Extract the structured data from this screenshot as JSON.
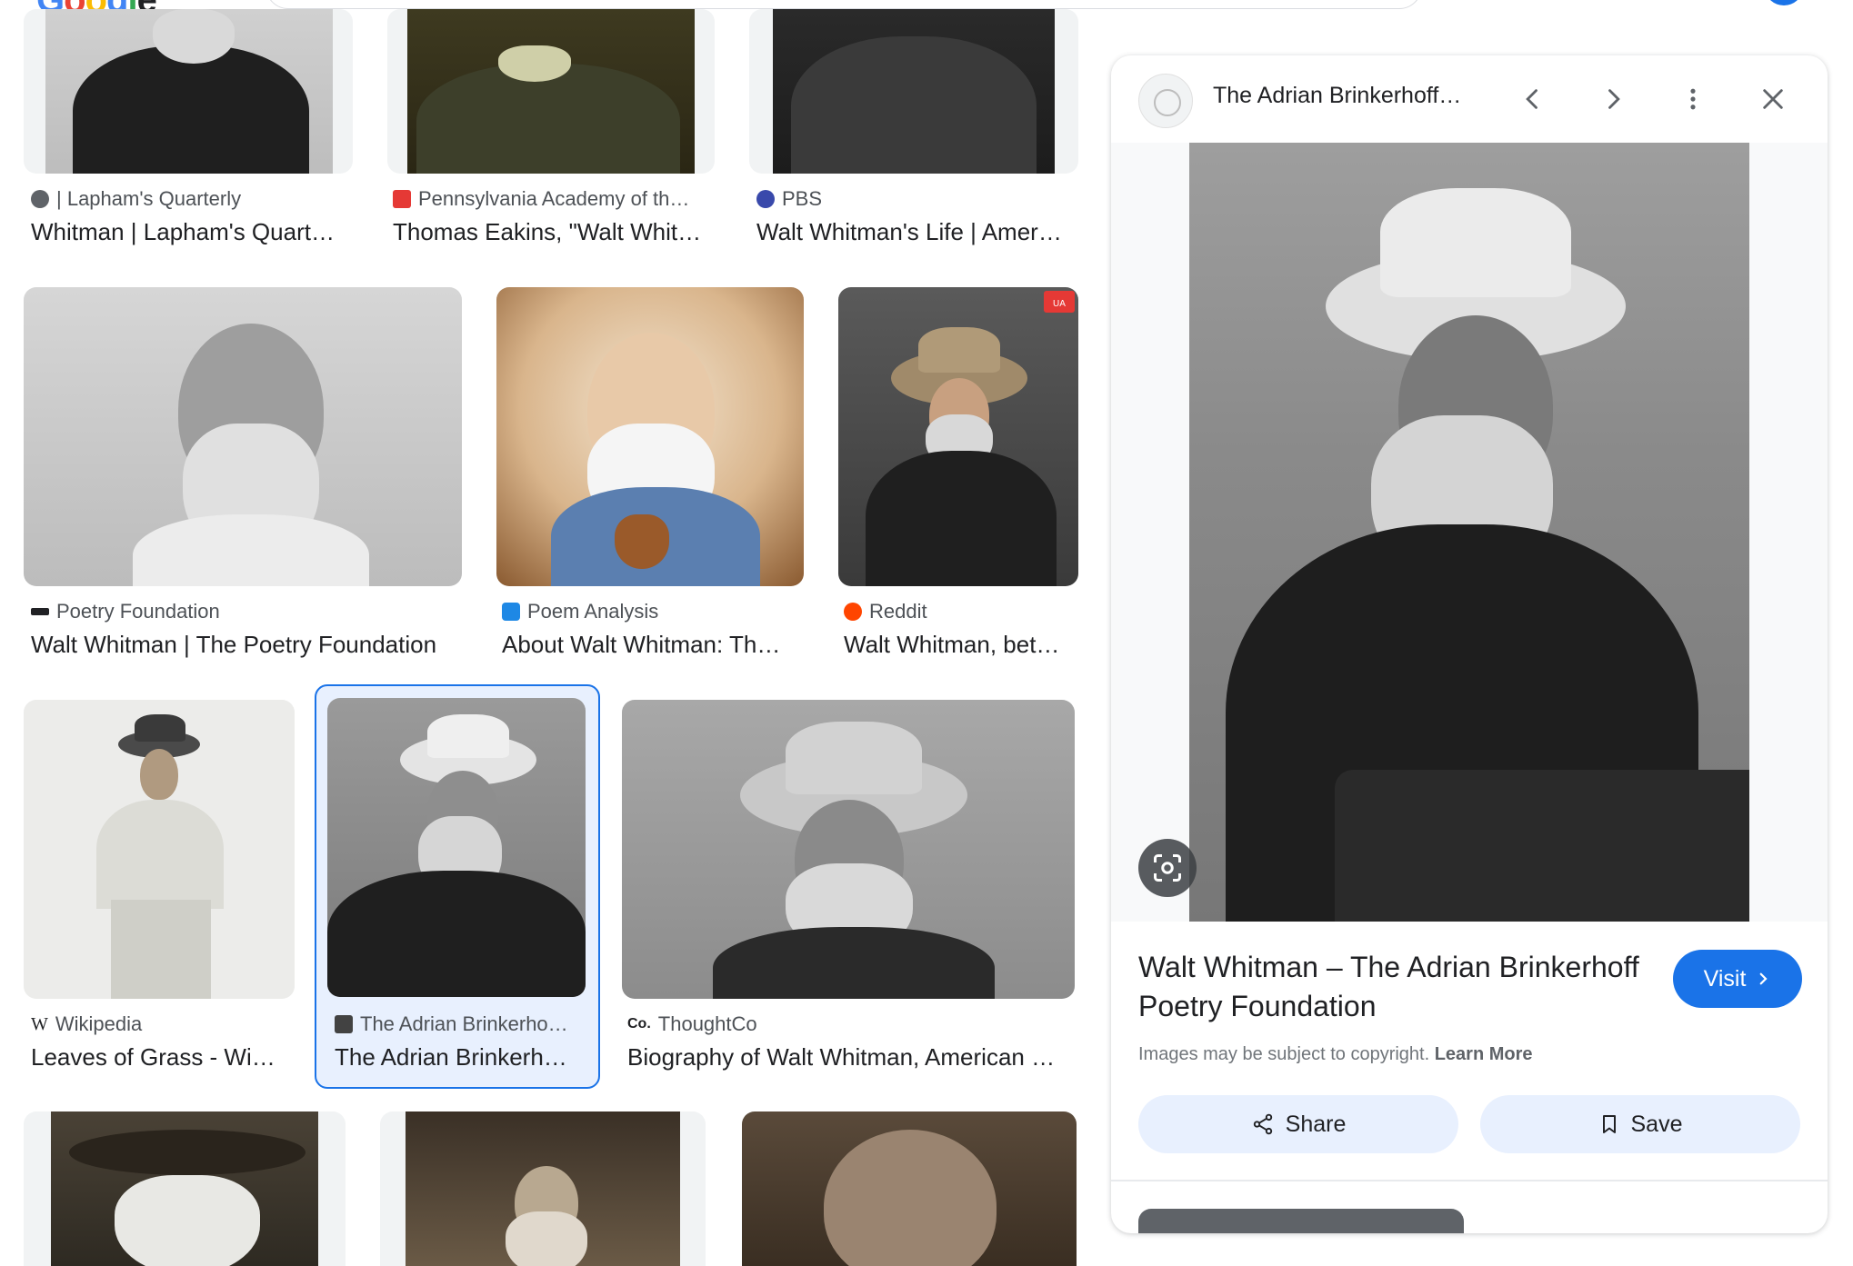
{
  "header": {
    "logo_text": [
      "G",
      "o",
      "o",
      "g",
      "l",
      "e"
    ]
  },
  "results": [
    {
      "source": "| Lapham's Quarterly",
      "title": "Whitman | Lapham's Quart…",
      "favicon_color": "#5f6368"
    },
    {
      "source": "Pennsylvania Academy of th…",
      "title": "Thomas Eakins, \"Walt Whit…",
      "favicon_color": "#e53935"
    },
    {
      "source": "PBS",
      "title": "Walt Whitman's Life | Amer…",
      "favicon_color": "#3949ab"
    },
    {
      "source": "Poetry Foundation",
      "title": "Walt Whitman | The Poetry Foundation",
      "favicon_color": "#202124"
    },
    {
      "source": "Poem Analysis",
      "title": "About Walt Whitman: Th…",
      "favicon_color": "#1e88e5"
    },
    {
      "source": "Reddit",
      "title": "Walt Whitman, bet…",
      "favicon_color": "#ff4500"
    },
    {
      "source": "Wikipedia",
      "title": "Leaves of Grass - Wi…",
      "favicon_color": "#202124",
      "favicon_glyph": "W"
    },
    {
      "source": "The Adrian Brinkerho…",
      "title": "The Adrian Brinkerh…",
      "favicon_color": "#424242"
    },
    {
      "source": "ThoughtCo",
      "title": "Biography of Walt Whitman, American …",
      "favicon_color": "#202124",
      "favicon_glyph": "Co."
    }
  ],
  "reddit_badge": "UA",
  "panel": {
    "site_name": "The Adrian Brinkerhoff…",
    "title": "Walt Whitman – The Adrian Brinkerhoff Poetry Foundation",
    "visit_label": "Visit",
    "copyright_text": "Images may be subject to copyright.",
    "learn_more": "Learn More",
    "share_label": "Share",
    "save_label": "Save"
  },
  "colors": {
    "accent": "#1a73e8",
    "selected_bg": "#e8f0fe",
    "pill_bg": "#e8f0fe"
  },
  "icons": [
    "prev-icon",
    "next-icon",
    "more-icon",
    "close-icon",
    "lens-icon",
    "share-icon",
    "bookmark-icon",
    "chevron-right-icon"
  ]
}
